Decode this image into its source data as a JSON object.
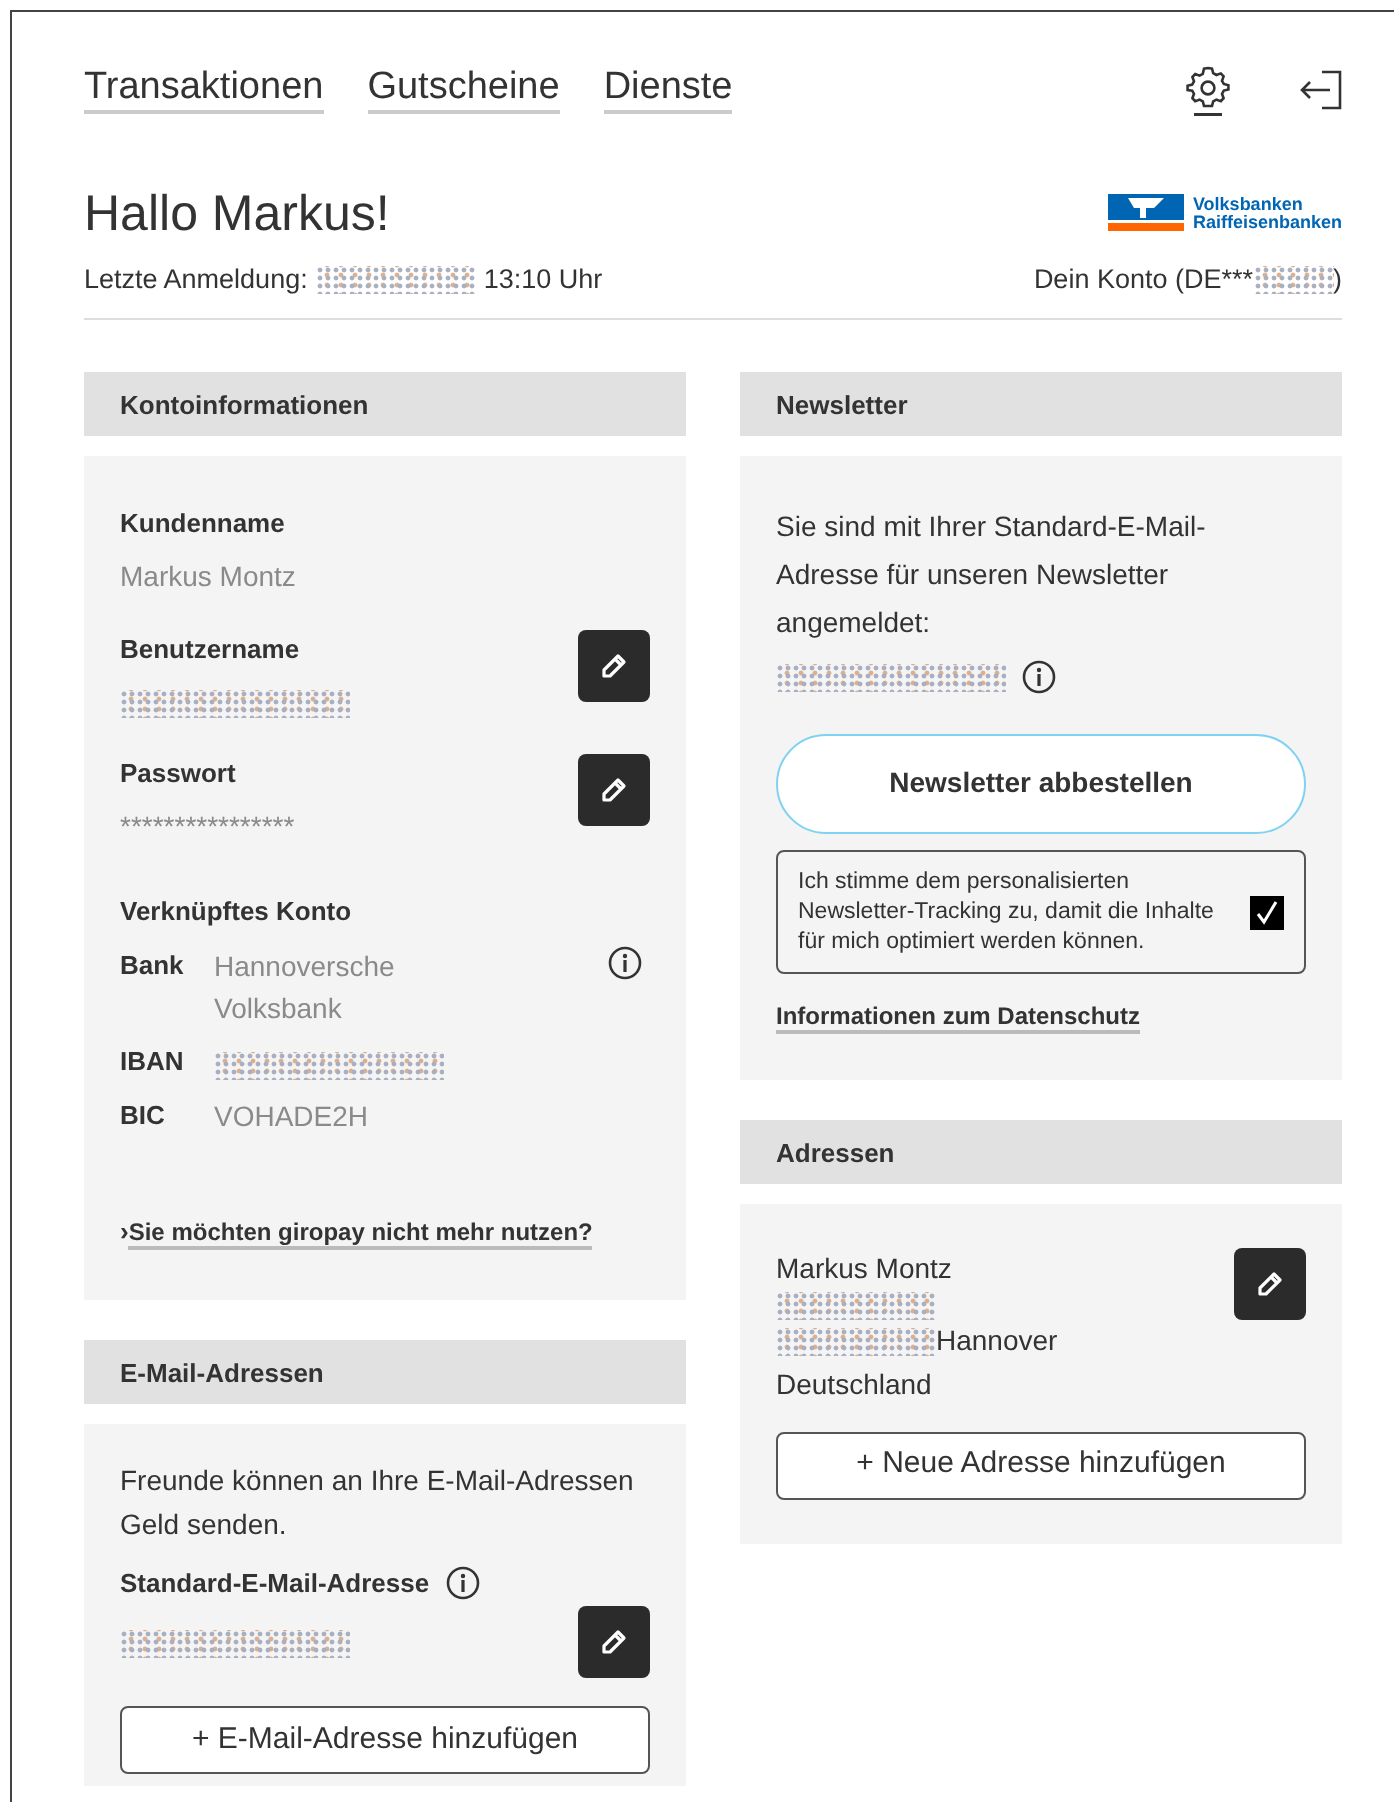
{
  "nav": {
    "links": [
      {
        "label": "Transaktionen"
      },
      {
        "label": "Gutscheine"
      },
      {
        "label": "Dienste"
      }
    ]
  },
  "greeting": "Hallo Markus!",
  "logo": {
    "line_1": "Volksbanken",
    "line_2": "Raiffeisenbanken"
  },
  "last_login": {
    "label": "Letzte Anmeldung:",
    "value": [
      {
        "kind": "blur"
      },
      {
        "kind": "text",
        "text": "13:10 Uhr"
      }
    ]
  },
  "account": [
    {
      "kind": "text",
      "text": "Dein Konto (DE***"
    },
    {
      "kind": "blur"
    },
    {
      "kind": "text",
      "text": ")"
    }
  ],
  "account_info": {
    "title": "Kontoinformationen",
    "fields": [
      {
        "label": "Kundenname",
        "value": [
          {
            "kind": "text",
            "text": "Markus Montz"
          }
        ],
        "editable": false
      },
      {
        "label": "Benutzername",
        "value": [
          {
            "kind": "blur"
          }
        ],
        "editable": true
      },
      {
        "label": "Passwort",
        "value": [
          {
            "kind": "text",
            "text": "****************"
          }
        ],
        "editable": true
      }
    ],
    "linked_account": {
      "title": "Verknüpftes Konto",
      "rows": [
        {
          "label": "Bank",
          "value": [
            {
              "kind": "text",
              "text": "Hannoversche Volksbank"
            }
          ],
          "info": true
        },
        {
          "label": "IBAN",
          "value": [
            {
              "kind": "blur"
            }
          ],
          "info": false
        },
        {
          "label": "BIC",
          "value": [
            {
              "kind": "text",
              "text": "VOHADE2H"
            }
          ],
          "info": false
        }
      ]
    },
    "link": {
      "prefix": "›",
      "text": "Sie möchten giropay nicht mehr nutzen?"
    }
  },
  "email": {
    "title": "E-Mail-Adressen",
    "intro": "Freunde können an Ihre E-Mail-Adressen Geld senden.",
    "label": "Standard-E-Mail-Adresse",
    "value": [
      {
        "kind": "blur"
      }
    ],
    "add_button": {
      "icon": "+",
      "label": "E-Mail-Adresse hinzufügen"
    }
  },
  "newsletter": {
    "title": "Newsletter",
    "text": "Sie sind mit Ihrer Standard-E-Mail-Adresse für unseren Newsletter angemeldet:",
    "email": [
      {
        "kind": "blur"
      }
    ],
    "unsubscribe": "Newsletter abbestellen",
    "consent": {
      "text": "Ich stimme dem personalisierten Newsletter-Tracking zu, damit die Inhalte für mich optimiert werden können.",
      "checked": true
    },
    "privacy_link": "Informationen zum Datenschutz"
  },
  "addresses": {
    "title": "Adressen",
    "lines": [
      [
        {
          "kind": "text",
          "text": "Markus Montz"
        }
      ],
      [
        {
          "kind": "blur"
        }
      ],
      [
        {
          "kind": "blur"
        },
        {
          "kind": "text",
          "text": "Hannover"
        }
      ],
      [
        {
          "kind": "text",
          "text": "Deutschland"
        }
      ]
    ],
    "add_button": {
      "icon": "+",
      "label": "Neue Adresse hinzufügen"
    }
  }
}
